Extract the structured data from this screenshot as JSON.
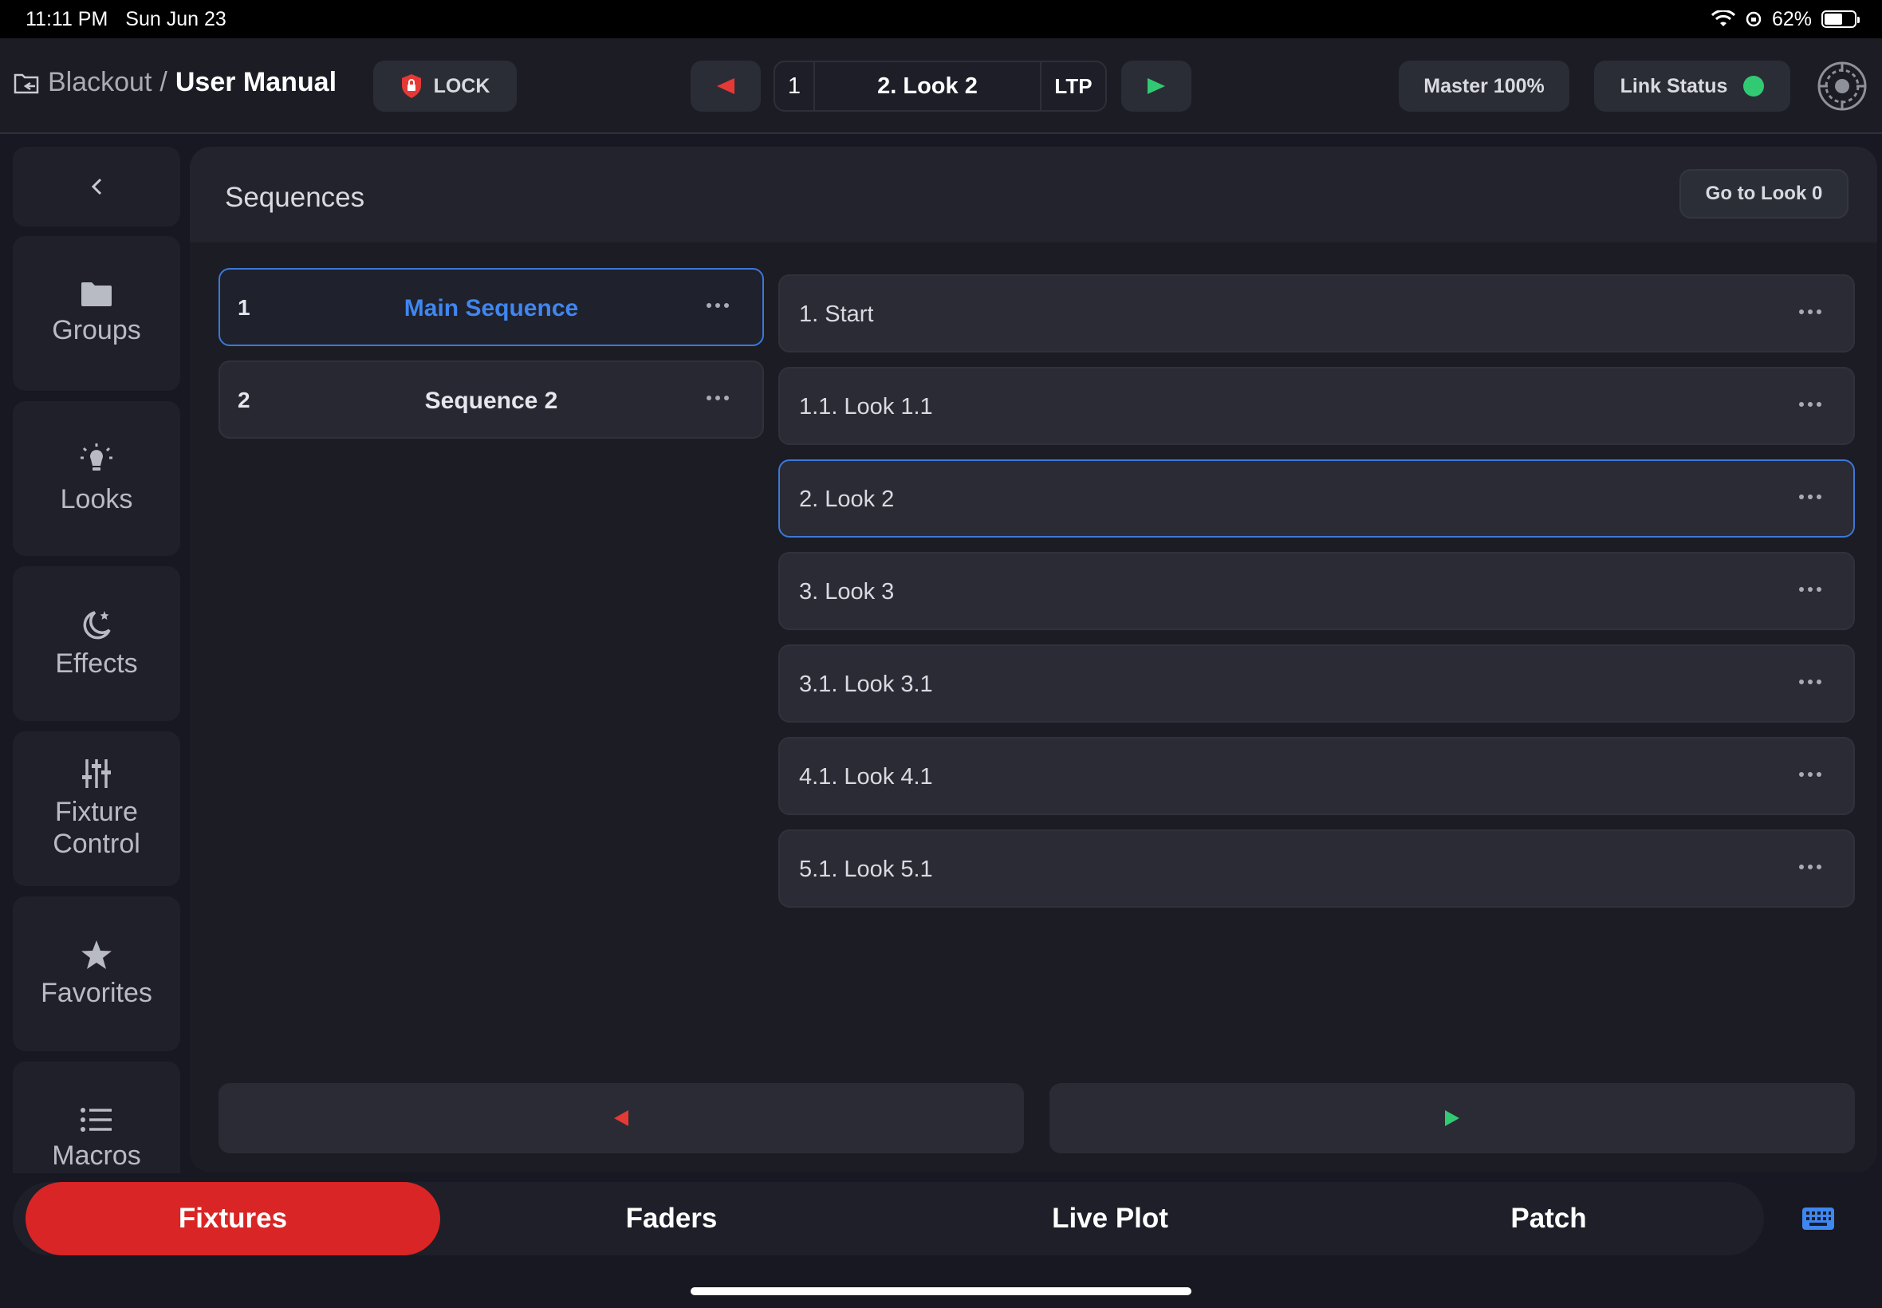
{
  "status_bar": {
    "time": "11:11 PM",
    "date": "Sun Jun 23",
    "battery": "62%",
    "battery_level": 0.62
  },
  "header": {
    "workspace": "Blackout",
    "separator": "/",
    "project": "User Manual",
    "lock_label": "LOCK",
    "cue_number": "1",
    "cue_name": "2. Look 2",
    "cue_mode": "LTP",
    "master_label": "Master 100%",
    "link_label": "Link Status",
    "link_color": "#32c973"
  },
  "sidebar": {
    "items": [
      {
        "label": "Groups",
        "icon": "folder-icon"
      },
      {
        "label": "Looks",
        "icon": "lightbulb-icon"
      },
      {
        "label": "Effects",
        "icon": "moon-star-icon"
      },
      {
        "label_line1": "Fixture",
        "label_line2": "Control",
        "icon": "sliders-icon"
      },
      {
        "label": "Favorites",
        "icon": "star-icon"
      },
      {
        "label": "Macros",
        "icon": "list-icon"
      }
    ]
  },
  "panel": {
    "title": "Sequences",
    "goto_label": "Go to Look 0",
    "sequences": [
      {
        "num": "1",
        "name": "Main Sequence",
        "active": true
      },
      {
        "num": "2",
        "name": "Sequence 2",
        "active": false
      }
    ],
    "looks": [
      {
        "label": "1. Start"
      },
      {
        "label": "1.1. Look 1.1"
      },
      {
        "label": "2. Look 2",
        "active": true
      },
      {
        "label": "3. Look 3"
      },
      {
        "label": "3.1. Look 3.1"
      },
      {
        "label": "4.1. Look 4.1"
      },
      {
        "label": "5.1. Look 5.1"
      }
    ]
  },
  "tabs": [
    {
      "label": "Fixtures",
      "active": true
    },
    {
      "label": "Faders"
    },
    {
      "label": "Live Plot"
    },
    {
      "label": "Patch"
    }
  ],
  "colors": {
    "accent_red": "#d92525",
    "accent_blue": "#3f86f0",
    "go_green": "#32c973",
    "back_red": "#e53935"
  }
}
